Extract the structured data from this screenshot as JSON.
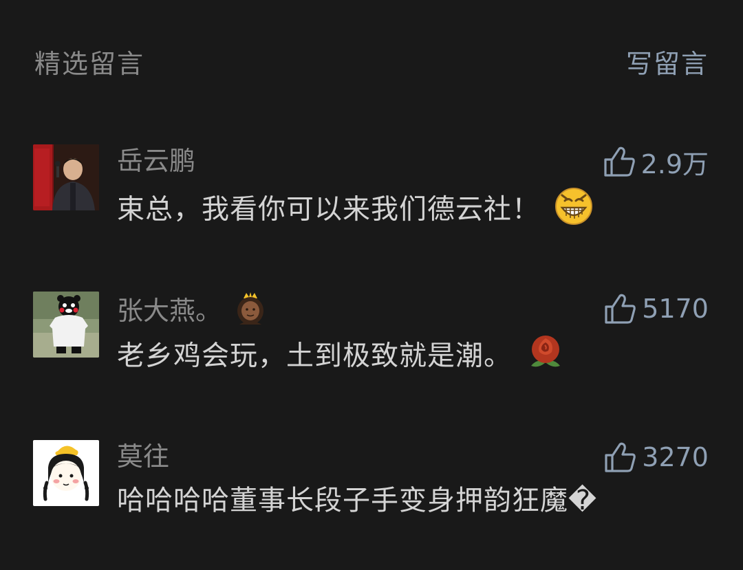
{
  "header": {
    "title": "精选留言",
    "write_label": "写留言"
  },
  "comments": [
    {
      "nickname": "岳云鹏",
      "likes": "2.9万",
      "text": "束总，我看你可以来我们德云社！",
      "emoji": "grinning-face-icon"
    },
    {
      "nickname": "张大燕。",
      "likes": "5170",
      "text": "老乡鸡会玩，土到极致就是潮。",
      "emoji": "rose-icon",
      "nickname_emoji": "princess-icon"
    },
    {
      "nickname": "莫往",
      "likes": "3270",
      "text": "哈哈哈哈董事长段子手变身押韵狂魔�"
    }
  ],
  "colors": {
    "background": "#191919",
    "nickname": "#8a8a8a",
    "content": "#d4d4d4",
    "accent": "#8fa0b4"
  }
}
